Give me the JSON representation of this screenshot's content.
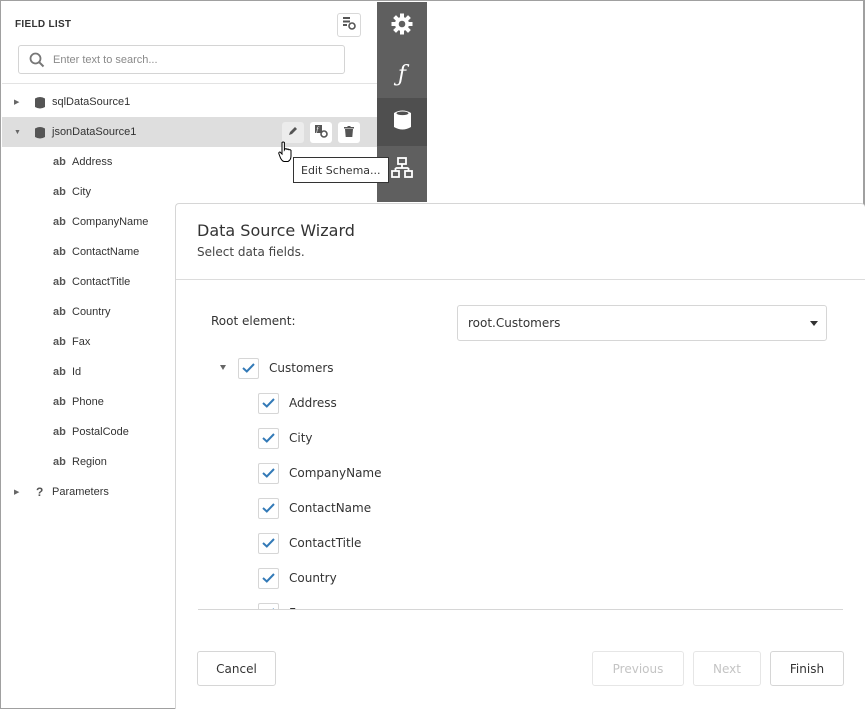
{
  "field_list": {
    "title": "FIELD LIST",
    "search_placeholder": "Enter text to search...",
    "data_sources": [
      {
        "label": "sqlDataSource1",
        "expanded": false
      },
      {
        "label": "jsonDataSource1",
        "expanded": true,
        "selected": true
      }
    ],
    "json_fields": [
      "Address",
      "City",
      "CompanyName",
      "ContactName",
      "ContactTitle",
      "Country",
      "Fax",
      "Id",
      "Phone",
      "PostalCode",
      "Region"
    ],
    "field_type_badge": "ab",
    "parameters_label": "Parameters",
    "parameters_icon_glyph": "?",
    "row_actions": [
      "edit-icon",
      "calculated-field-icon",
      "delete-icon"
    ],
    "tooltip": "Edit Schema..."
  },
  "tab_strip": {
    "tabs": [
      {
        "name": "properties",
        "icon": "gear-icon"
      },
      {
        "name": "expressions",
        "icon": "function-icon",
        "glyph": "ƒ"
      },
      {
        "name": "field-list",
        "icon": "database-icon",
        "active": true
      },
      {
        "name": "report-explorer",
        "icon": "hierarchy-icon"
      }
    ]
  },
  "wizard": {
    "title": "Data Source Wizard",
    "subtitle": "Select data fields.",
    "root_label": "Root element:",
    "root_value": "root.Customers",
    "root_node": {
      "label": "Customers",
      "checked": true,
      "expanded": true
    },
    "fields": [
      {
        "label": "Address",
        "checked": true
      },
      {
        "label": "City",
        "checked": true
      },
      {
        "label": "CompanyName",
        "checked": true
      },
      {
        "label": "ContactName",
        "checked": true
      },
      {
        "label": "ContactTitle",
        "checked": true
      },
      {
        "label": "Country",
        "checked": true
      },
      {
        "label": "Fax",
        "checked": true
      }
    ],
    "buttons": {
      "cancel": "Cancel",
      "previous": "Previous",
      "next": "Next",
      "finish": "Finish"
    },
    "accent_color": "#337ab7"
  }
}
